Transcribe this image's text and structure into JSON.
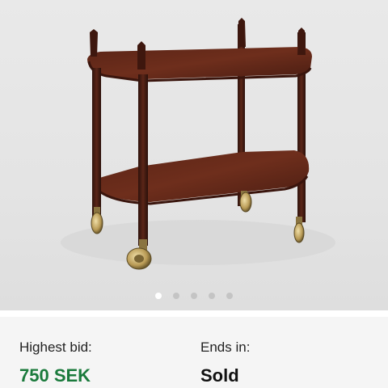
{
  "gallery": {
    "image_alt": "Wooden serving trolley with two trays and brass castors",
    "dot_count": 5,
    "active_index": 0
  },
  "bid": {
    "label": "Highest bid:",
    "value": "750 SEK",
    "value_color": "#1a7a3c"
  },
  "ends": {
    "label": "Ends in:",
    "value": "Sold"
  }
}
